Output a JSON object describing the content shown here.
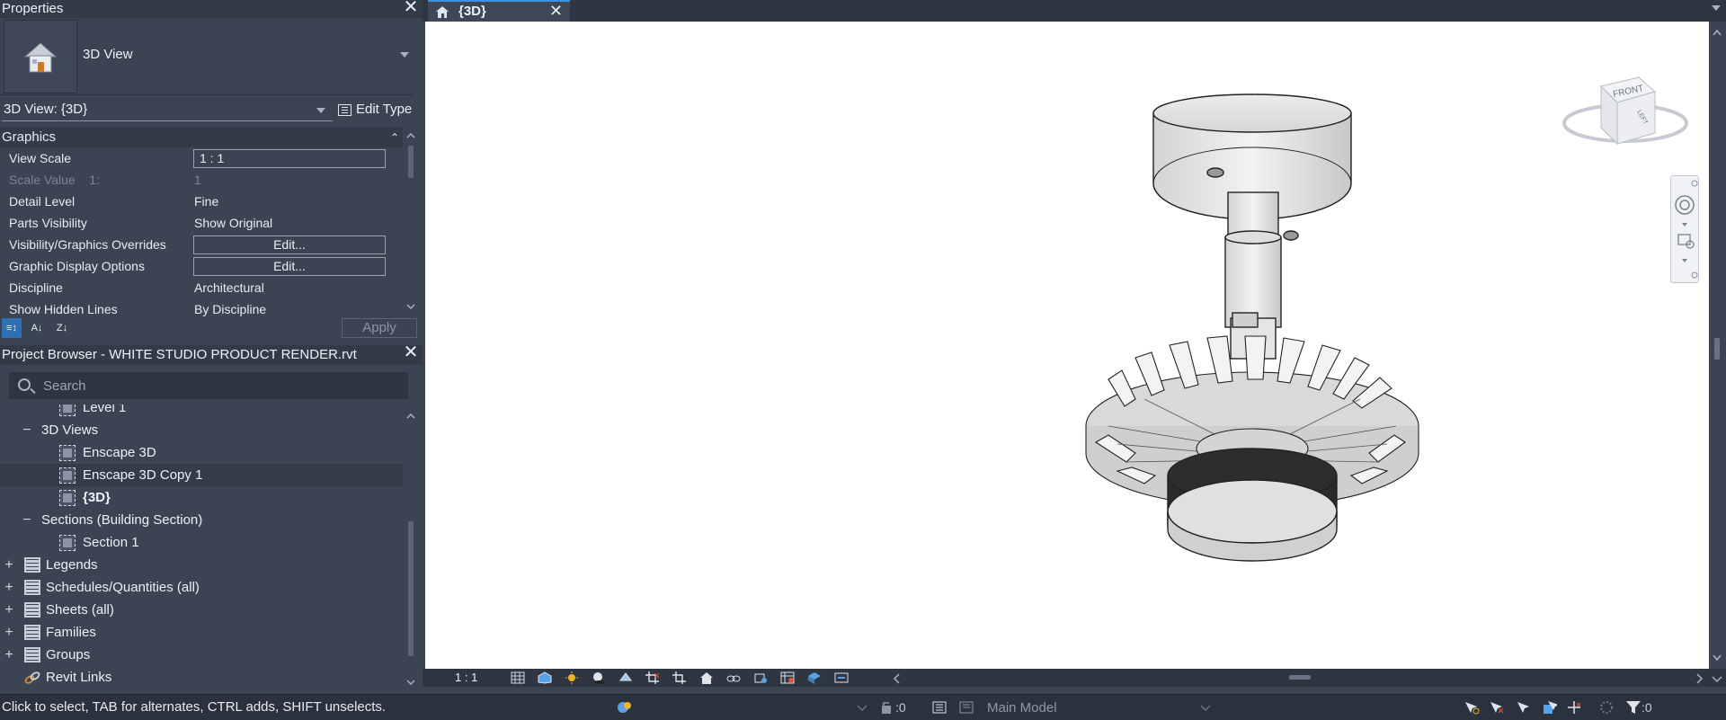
{
  "properties": {
    "title": "Properties",
    "type_name": "3D View",
    "instance_selector": "3D View: {3D}",
    "edit_type": "Edit Type",
    "group": "Graphics",
    "rows": [
      {
        "key": "View Scale",
        "value": "1 : 1"
      },
      {
        "key": "Scale Value    1:",
        "value": "1"
      },
      {
        "key": "Detail Level",
        "value": "Fine"
      },
      {
        "key": "Parts Visibility",
        "value": "Show Original"
      },
      {
        "key": "Visibility/Graphics Overrides",
        "value": "Edit..."
      },
      {
        "key": "Graphic Display Options",
        "value": "Edit..."
      },
      {
        "key": "Discipline",
        "value": "Architectural"
      },
      {
        "key": "Show Hidden Lines",
        "value": "By Discipline"
      }
    ],
    "apply": "Apply"
  },
  "browser": {
    "title": "Project Browser - WHITE STUDIO PRODUCT RENDER.rvt",
    "search_placeholder": "Search",
    "nodes": [
      "Level 1",
      "3D Views",
      "Enscape 3D",
      "Enscape 3D Copy 1",
      "{3D}",
      "Sections (Building Section)",
      "Section 1",
      "Legends",
      "Schedules/Quantities (all)",
      "Sheets (all)",
      "Families",
      "Groups",
      "Revit Links"
    ]
  },
  "view_tab": {
    "label": "{3D}"
  },
  "viewcube": {
    "top": "FRONT",
    "right": "LEFT"
  },
  "view_control": {
    "scale": "1 : 1"
  },
  "status": {
    "message": "Click to select, TAB for alternates, CTRL adds, SHIFT unselects.",
    "worksets_count": ":0",
    "active_model": "Main Model",
    "filter_count": ":0"
  },
  "colors": {
    "accent": "#2f6fb3",
    "panel": "#3b4453",
    "header": "#333b48"
  }
}
